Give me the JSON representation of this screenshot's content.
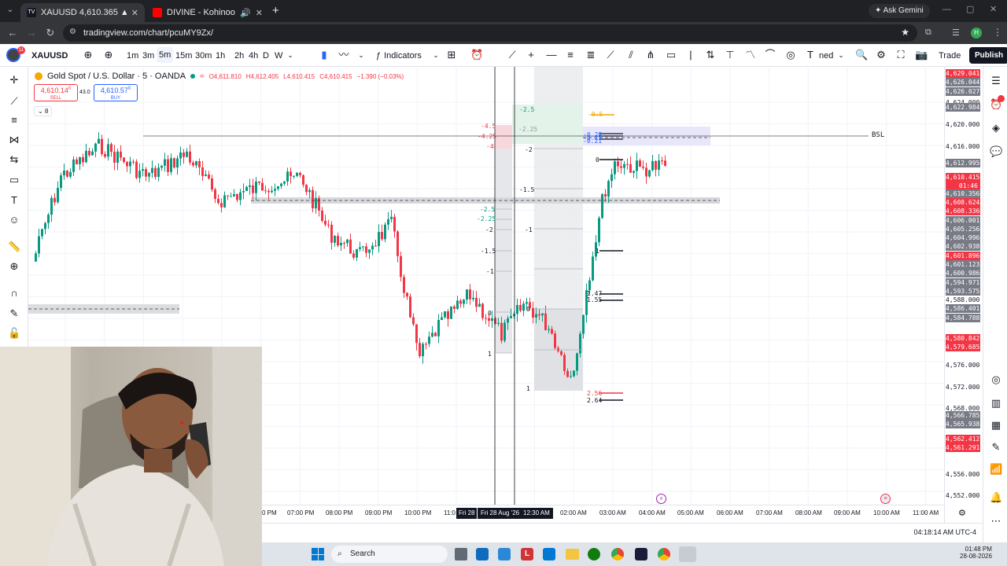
{
  "browser": {
    "tabs": [
      {
        "title": "XAUUSD 4,610.365 ▲ +0.18% U",
        "active": true
      },
      {
        "title": "DIVINE - Kohinoor (Official",
        "active": false
      }
    ],
    "new_tab": "+",
    "ask_gemini": "Ask Gemini",
    "url": "tradingview.com/chart/pcuMY9Zx/",
    "profile_initial": "H"
  },
  "toolbar": {
    "symbol": "XAUUSD",
    "badge": "11",
    "intervals": [
      "1m",
      "3m",
      "5m",
      "15m",
      "30m",
      "1h",
      "2h",
      "4h",
      "D",
      "W"
    ],
    "indicators_label": "Indicators",
    "named_label": "ned",
    "trade_label": "Trade",
    "publish_label": "Publish"
  },
  "chart": {
    "title": "Gold Spot / U.S. Dollar · 5 · OANDA",
    "ohlc": {
      "o": "O4,611.810",
      "h": "H4,612.405",
      "l": "L4,610.415",
      "c": "C4,610.415",
      "chg": "−1.390 (−0.03%)"
    },
    "sell_price": "4,610.14",
    "sell_sup": "0",
    "sell_label": "SELL",
    "spread": "43.0",
    "buy_price": "4,610.57",
    "buy_sup": "0",
    "buy_label": "BUY",
    "layers_count": "8",
    "bsl_label": "BSL",
    "fib_labels_left": [
      "-4.5",
      "-4.25",
      "-4",
      "-2.25",
      "-2.5",
      "-2.25",
      "-2",
      "-1.5",
      "-1",
      "0",
      "1"
    ],
    "fib_labels_mid": [
      "-2.5",
      "-2",
      "-1.5",
      "-1",
      "0",
      "1"
    ],
    "fib_labels_right": [
      "-0.5",
      "-0.28",
      "-0.25",
      "-0.21",
      "0",
      "1",
      "1.47",
      "1.55",
      "2.56",
      "2.64"
    ],
    "time_labels": [
      "0 PM",
      "07:00 PM",
      "08:00 PM",
      "09:00 PM",
      "10:00 PM",
      "11:0",
      "02:00 AM",
      "03:00 AM",
      "04:00 AM",
      "05:00 AM",
      "06:00 AM",
      "07:00 AM",
      "08:00 AM",
      "09:00 AM",
      "10:00 AM",
      "11:00 AM"
    ],
    "crosshair_time_a": "Fri 28",
    "crosshair_time_b": "Fri 28 Aug '26",
    "crosshair_time_c": "12:30 AM",
    "clock": "04:18:14 AM UTC-4"
  },
  "price_axis": [
    {
      "v": "4,629.041",
      "kind": "red"
    },
    {
      "v": "4,626.044",
      "kind": "gray"
    },
    {
      "v": "4,626.027",
      "kind": "gray"
    },
    {
      "v": "4,624.000",
      "kind": "plain"
    },
    {
      "v": "4,622.984",
      "kind": "gray"
    },
    {
      "v": "4,620.000",
      "kind": "plain"
    },
    {
      "v": "4,616.000",
      "kind": "plain"
    },
    {
      "v": "4,612.995",
      "kind": "gray"
    },
    {
      "v": "4,610.415",
      "kind": "red"
    },
    {
      "v": "01:46",
      "kind": "red"
    },
    {
      "v": "4,610.356",
      "kind": "gray"
    },
    {
      "v": "4,608.624",
      "kind": "red"
    },
    {
      "v": "4,608.336",
      "kind": "red"
    },
    {
      "v": "4,606.001",
      "kind": "gray"
    },
    {
      "v": "4,605.256",
      "kind": "gray"
    },
    {
      "v": "4,604.996",
      "kind": "gray"
    },
    {
      "v": "4,602.938",
      "kind": "gray"
    },
    {
      "v": "4,601.896",
      "kind": "red"
    },
    {
      "v": "4,601.123",
      "kind": "gray"
    },
    {
      "v": "4,600.986",
      "kind": "gray"
    },
    {
      "v": "4,594.971",
      "kind": "gray"
    },
    {
      "v": "4,593.575",
      "kind": "gray"
    },
    {
      "v": "4,588.000",
      "kind": "plain"
    },
    {
      "v": "4,586.401",
      "kind": "gray"
    },
    {
      "v": "4,584.788",
      "kind": "gray"
    },
    {
      "v": "4,580.842",
      "kind": "red"
    },
    {
      "v": "4,579.685",
      "kind": "red"
    },
    {
      "v": "4,576.000",
      "kind": "plain"
    },
    {
      "v": "4,572.000",
      "kind": "plain"
    },
    {
      "v": "4,568.000",
      "kind": "plain"
    },
    {
      "v": "4,566.785",
      "kind": "gray"
    },
    {
      "v": "4,565.938",
      "kind": "gray"
    },
    {
      "v": "4,562.412",
      "kind": "red"
    },
    {
      "v": "4,561.291",
      "kind": "red"
    },
    {
      "v": "4,556.000",
      "kind": "plain"
    },
    {
      "v": "4,552.000",
      "kind": "plain"
    }
  ],
  "taskbar": {
    "search_label": "Search",
    "time": "01:48 PM",
    "date": "28-08-2026"
  },
  "colors": {
    "up": "#089981",
    "down": "#f23645",
    "accent": "#2962ff"
  }
}
